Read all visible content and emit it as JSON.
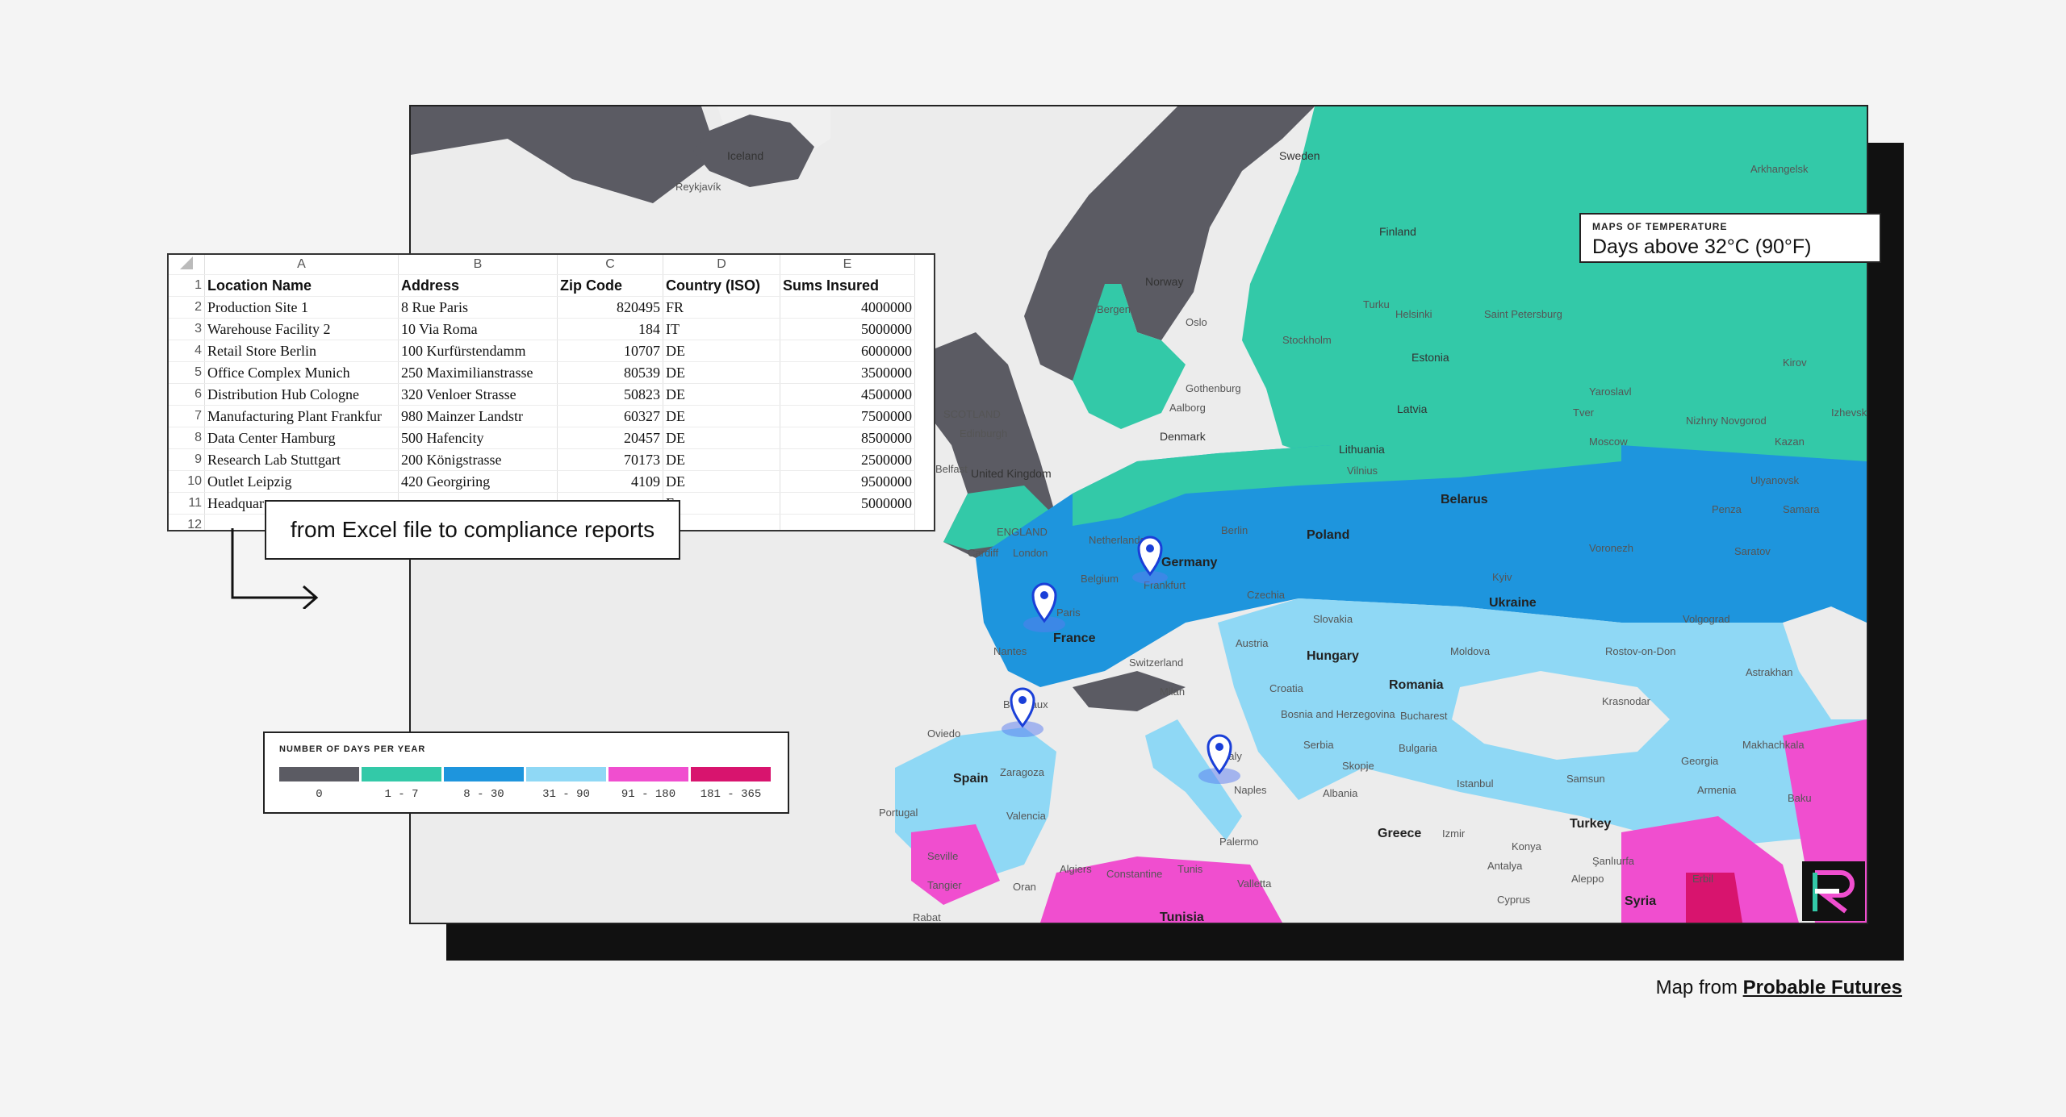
{
  "map": {
    "labels": {
      "iceland": "Iceland",
      "reykjavik": "Reykjavík",
      "sweden": "Sweden",
      "finland": "Finland",
      "norway": "Norway",
      "bergen": "Bergen",
      "oslo": "Oslo",
      "stockholm": "Stockholm",
      "turku": "Turku",
      "helsinki": "Helsinki",
      "saint_petersburg": "Saint Petersburg",
      "arkhangelsk": "Arkhangelsk",
      "estonia": "Estonia",
      "kirov": "Kirov",
      "gothenburg": "Gothenburg",
      "aalborg": "Aalborg",
      "denmark": "Denmark",
      "latvia": "Latvia",
      "yaroslavl": "Yaroslavl",
      "tver": "Tver",
      "izhevsk": "Izhevsk",
      "nizhny_novgorod": "Nizhny Novgorod",
      "moscow": "Moscow",
      "kazan": "Kazan",
      "lithuania": "Lithuania",
      "vilnius": "Vilnius",
      "ulyanovsk": "Ulyanovsk",
      "scotland": "SCOTLAND",
      "edinburgh": "Edinburgh",
      "belfast": "Belfast",
      "united_kingdom": "United Kingdom",
      "england": "ENGLAND",
      "cardiff": "Cardiff",
      "london": "London",
      "netherlands": "Netherlands",
      "belgium": "Belgium",
      "germany": "Germany",
      "berlin": "Berlin",
      "poland": "Poland",
      "belarus": "Belarus",
      "penza": "Penza",
      "samara": "Samara",
      "voronezh": "Voronezh",
      "saratov": "Saratov",
      "frankfurt": "Frankfurt",
      "czechia": "Czechia",
      "kyiv": "Kyiv",
      "ukraine": "Ukraine",
      "paris": "Paris",
      "slovakia": "Slovakia",
      "volgograd": "Volgograd",
      "france": "France",
      "nantes": "Nantes",
      "austria": "Austria",
      "hungary": "Hungary",
      "moldova": "Moldova",
      "rostov": "Rostov-on-Don",
      "switzerland": "Switzerland",
      "astrakhan": "Astrakhan",
      "milan": "Milan",
      "croatia": "Croatia",
      "romania": "Romania",
      "bordeaux": "Bordeaux",
      "krasnodar": "Krasnodar",
      "bosnia": "Bosnia and Herzegovina",
      "bucharest": "Bucharest",
      "makhachkala": "Makhachkala",
      "oviedo": "Oviedo",
      "italy": "Italy",
      "serbia": "Serbia",
      "bulgaria": "Bulgaria",
      "georgia": "Georgia",
      "spain": "Spain",
      "zaragoza": "Zaragoza",
      "skopje": "Skopje",
      "istanbul": "Istanbul",
      "samsun": "Samsun",
      "naples": "Naples",
      "albania": "Albania",
      "armenia": "Armenia",
      "baku": "Baku",
      "portugal": "Portugal",
      "valencia": "Valencia",
      "greece": "Greece",
      "izmir": "Izmir",
      "turkey": "Turkey",
      "palermo": "Palermo",
      "konya": "Konya",
      "seville": "Seville",
      "algiers": "Algiers",
      "constantine": "Constantine",
      "tunis": "Tunis",
      "antalya": "Antalya",
      "sanliurfa": "Şanlıurfa",
      "tangier": "Tangier",
      "oran": "Oran",
      "valletta": "Valletta",
      "aleppo": "Aleppo",
      "erbil": "Erbil",
      "cyprus": "Cyprus",
      "syria": "Syria",
      "tunisia": "Tunisia",
      "rabat": "Rabat"
    },
    "pins": [
      "paris-pin",
      "frankfurt-pin",
      "bordeaux-pin",
      "italy-pin"
    ]
  },
  "temperature_box": {
    "eyebrow": "MAPS OF TEMPERATURE",
    "title": "Days above 32°C (90°F)"
  },
  "spreadsheet": {
    "columns": [
      "A",
      "B",
      "C",
      "D",
      "E"
    ],
    "header": [
      "Location Name",
      "Address",
      "Zip Code",
      "Country (ISO)",
      "Sums Insured"
    ],
    "rows": [
      [
        "Production Site 1",
        "8 Rue Paris",
        "820495",
        "FR",
        "4000000"
      ],
      [
        "Warehouse Facility 2",
        "10 Via Roma",
        "184",
        "IT",
        "5000000"
      ],
      [
        "Retail Store Berlin",
        "100 Kurfürstendamm",
        "10707",
        "DE",
        "6000000"
      ],
      [
        "Office Complex Munich",
        "250 Maximilianstrasse",
        "80539",
        "DE",
        "3500000"
      ],
      [
        "Distribution Hub Cologne",
        "320 Venloer Strasse",
        "50823",
        "DE",
        "4500000"
      ],
      [
        "Manufacturing Plant Frankfur",
        "980 Mainzer Landstr",
        "60327",
        "DE",
        "7500000"
      ],
      [
        "Data Center Hamburg",
        "500 Hafencity",
        "20457",
        "DE",
        "8500000"
      ],
      [
        "Research Lab Stuttgart",
        "200 Königstrasse",
        "70173",
        "DE",
        "2500000"
      ],
      [
        "Outlet Leipzig",
        "420 Georgiring",
        "4109",
        "DE",
        "9500000"
      ],
      [
        "Headquar",
        "",
        "",
        "E",
        "5000000"
      ]
    ],
    "row_numbers": [
      "1",
      "2",
      "3",
      "4",
      "5",
      "6",
      "7",
      "8",
      "9",
      "10",
      "11",
      "12"
    ]
  },
  "caption": "from Excel file to compliance reports",
  "legend": {
    "title": "NUMBER OF DAYS PER YEAR",
    "items": [
      {
        "label": "0",
        "color": "#5b5b63"
      },
      {
        "label": "1 - 7",
        "color": "#33c9a8"
      },
      {
        "label": "8 - 30",
        "color": "#1e95dd"
      },
      {
        "label": "31 - 90",
        "color": "#8fd8f5"
      },
      {
        "label": "91 - 180",
        "color": "#f04ecf"
      },
      {
        "label": "181 - 365",
        "color": "#d8146e"
      }
    ]
  },
  "credit": {
    "prefix": "Map from ",
    "link": "Probable Futures"
  }
}
